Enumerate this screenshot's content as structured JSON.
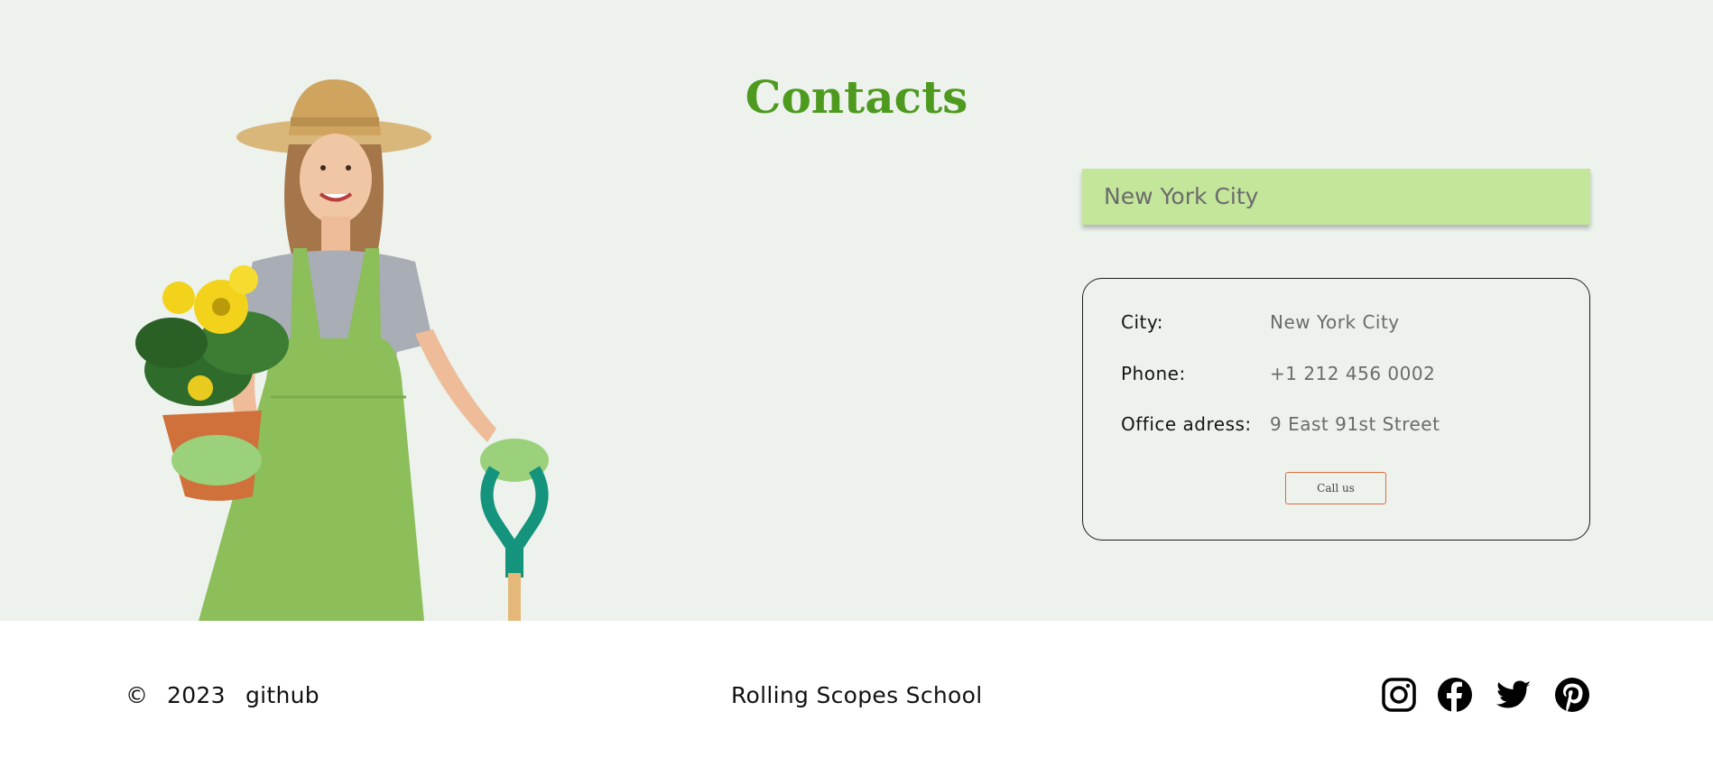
{
  "contacts": {
    "title": "Contacts",
    "city_select": "New York City",
    "card": {
      "rows": [
        {
          "label": "City:",
          "value": "New York City"
        },
        {
          "label": "Phone:",
          "value": "+1 212 456 0002"
        },
        {
          "label": "Office adress:",
          "value": "9 East 91st Street"
        }
      ],
      "call_button": "Call us"
    }
  },
  "footer": {
    "copyright_symbol": "©",
    "year": "2023",
    "github": "github",
    "school": "Rolling Scopes School",
    "social_icons": [
      "instagram-icon",
      "facebook-icon",
      "twitter-icon",
      "pinterest-icon"
    ]
  },
  "colors": {
    "title_green": "#4e9a1f",
    "select_bg": "#c3e69a",
    "section_bg": "#edf2ed",
    "button_border": "#e06a3a"
  }
}
